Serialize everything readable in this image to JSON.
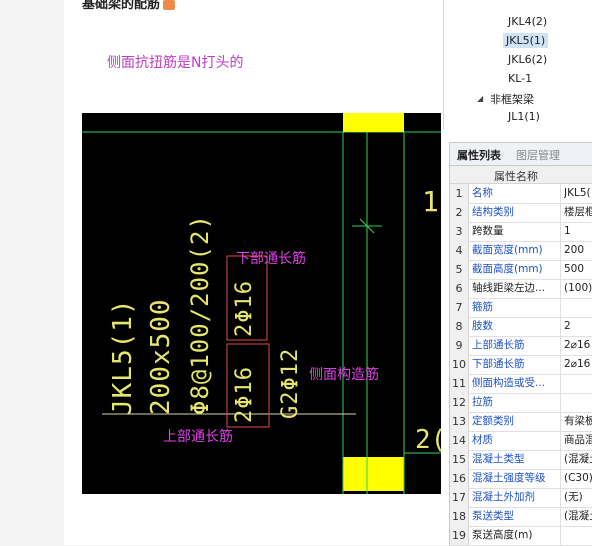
{
  "article": {
    "heading": "基础梁的配筋",
    "note": "侧面抗扭筋是N打头的"
  },
  "cad": {
    "beam_id": "JKL5(1)",
    "beam_size": "200x500",
    "stirrup": "Φ8@100/200(2)",
    "bottom_bar": "2Φ16",
    "top_bar": "2Φ16",
    "side_bar": "G2Φ12",
    "label_bottom": "下部通长筋",
    "label_side": "侧面构造筋",
    "label_top": "上部通长筋",
    "fragment_1": "1",
    "fragment_2": "2("
  },
  "tree": {
    "items": [
      "JKL4(2)",
      "JKL5(1)",
      "JKL6(2)",
      "KL-1",
      "非框架梁",
      "JL1(1)"
    ],
    "selected_index": 1
  },
  "props": {
    "tabs": [
      "属性列表",
      "图层管理"
    ],
    "header_name": "属性名称",
    "rows": [
      {
        "num": "1",
        "name": "名称",
        "value": "JKL5(",
        "style": "blue"
      },
      {
        "num": "2",
        "name": "结构类别",
        "value": "楼层框",
        "style": "blue"
      },
      {
        "num": "3",
        "name": "跨数量",
        "value": "1",
        "style": "black"
      },
      {
        "num": "4",
        "name": "截面宽度(mm)",
        "value": "200",
        "style": "blue"
      },
      {
        "num": "5",
        "name": "截面高度(mm)",
        "value": "500",
        "style": "blue"
      },
      {
        "num": "6",
        "name": "轴线距梁左边...",
        "value": "(100)",
        "style": "black"
      },
      {
        "num": "7",
        "name": "箍筋",
        "value": "",
        "style": "blue"
      },
      {
        "num": "8",
        "name": "肢数",
        "value": "2",
        "style": "blue"
      },
      {
        "num": "9",
        "name": "上部通长筋",
        "value": "2⌀16",
        "style": "blue"
      },
      {
        "num": "10",
        "name": "下部通长筋",
        "value": "2⌀16",
        "style": "blue"
      },
      {
        "num": "11",
        "name": "侧面构造或受...",
        "value": "",
        "style": "blue"
      },
      {
        "num": "12",
        "name": "拉筋",
        "value": "",
        "style": "blue"
      },
      {
        "num": "13",
        "name": "定额类别",
        "value": "有梁板",
        "style": "blue"
      },
      {
        "num": "14",
        "name": "材质",
        "value": "商品混",
        "style": "blue"
      },
      {
        "num": "15",
        "name": "混凝土类型",
        "value": "(混凝土",
        "style": "blue"
      },
      {
        "num": "16",
        "name": "混凝土强度等级",
        "value": "(C30)",
        "style": "blue"
      },
      {
        "num": "17",
        "name": "混凝土外加剂",
        "value": "(无)",
        "style": "blue"
      },
      {
        "num": "18",
        "name": "泵送类型",
        "value": "(混凝土",
        "style": "blue"
      },
      {
        "num": "19",
        "name": "泵送高度(m)",
        "value": "",
        "style": "black"
      }
    ]
  },
  "colors": {
    "cad_background": "#000000",
    "cad_text": "#e6e66a",
    "cad_highlight_box": "#e04a4a",
    "cad_label": "#e040e8",
    "cad_green_line": "#2fd35a",
    "cad_yellow_block": "#ffff00",
    "link_blue": "#1d52c7"
  }
}
